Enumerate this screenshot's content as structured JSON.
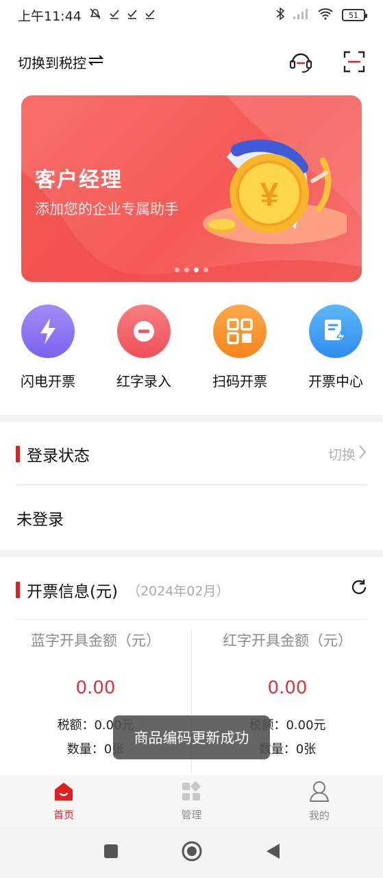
{
  "status_bar": {
    "time": "上午11:44",
    "battery": "51"
  },
  "header": {
    "switch_label": "切换到税控"
  },
  "banner": {
    "title": "客户经理",
    "subtitle": "添加您的企业专属助手",
    "slide_count": 4,
    "active_slide": 3
  },
  "quick_actions": [
    {
      "label": "闪电开票",
      "icon": "lightning-icon",
      "color": "#8f7cf0"
    },
    {
      "label": "红字录入",
      "icon": "minus-circle-icon",
      "color": "#f3616a"
    },
    {
      "label": "扫码开票",
      "icon": "qrcode-icon",
      "color": "#f7902f"
    },
    {
      "label": "开票中心",
      "icon": "invoice-center-icon",
      "color": "#3d9cf0"
    }
  ],
  "login_section": {
    "title": "登录状态",
    "switch_label": "切换",
    "value": "未登录"
  },
  "invoice_section": {
    "title": "开票信息(元)",
    "period": "（2024年02月）",
    "blue": {
      "title": "蓝字开具金额（元）",
      "amount": "0.00",
      "tax": "税额：0.00元",
      "count": "数量：0张"
    },
    "red": {
      "title": "红字开具金额（元）",
      "amount": "0.00",
      "tax": "税额：0.00元",
      "count": "数量：0张"
    }
  },
  "toast": "商品编码更新成功",
  "tabs": [
    {
      "label": "首页",
      "active": true
    },
    {
      "label": "管理",
      "active": false
    },
    {
      "label": "我的",
      "active": false
    }
  ],
  "colors": {
    "accent": "#e02020",
    "banner": "#f55a57",
    "amount": "#d9363e"
  }
}
